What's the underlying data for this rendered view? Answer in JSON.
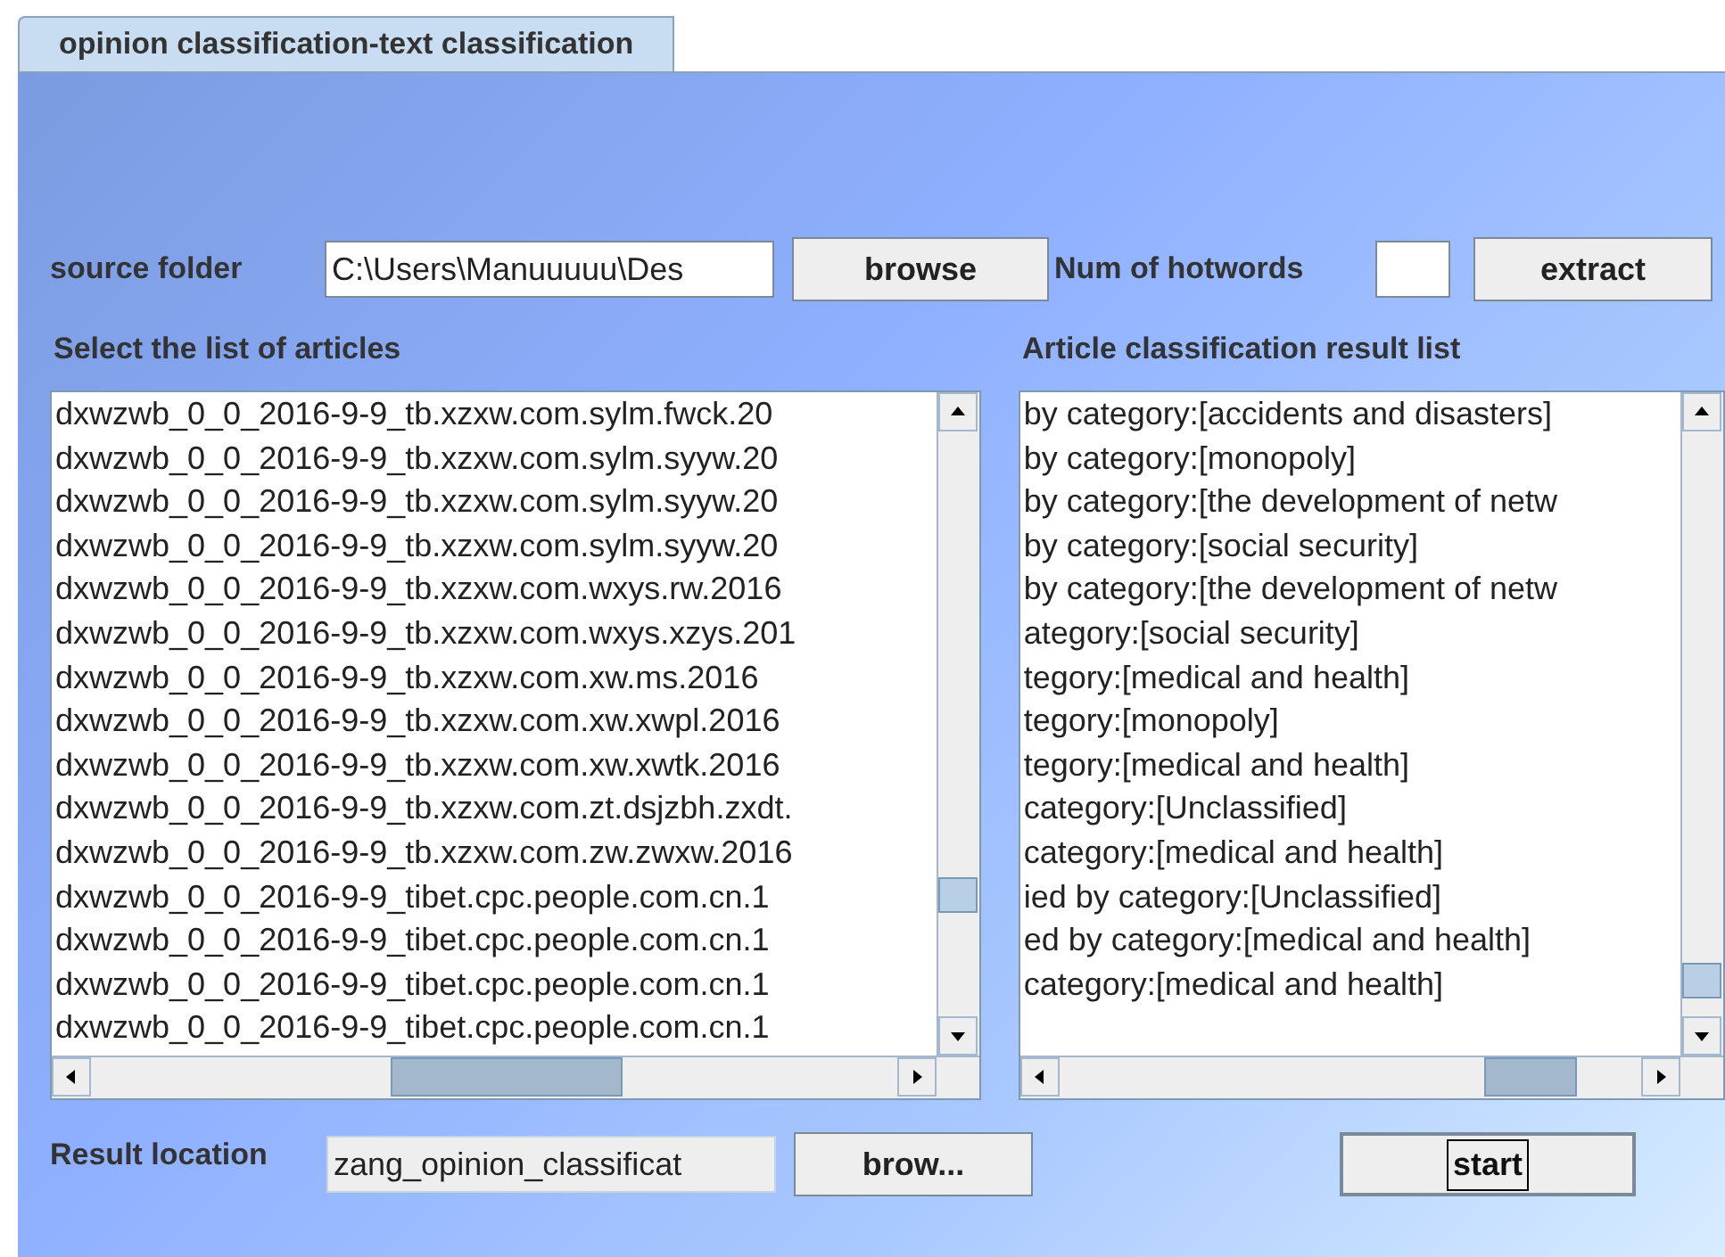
{
  "tabs": [
    {
      "label": "opinion classification-text classification",
      "selected": true
    }
  ],
  "source_folder": {
    "label": "source folder",
    "value": "C:\\Users\\Manuuuuu\\Des",
    "button": "browse"
  },
  "hotwords": {
    "label": "Num of hotwords",
    "button": "extract"
  },
  "articles": {
    "title": "Select the list of articles",
    "items": [
      "dxwzwb_0_0_2016-9-9_tb.xzxw.com.sylm.fwck.20",
      "dxwzwb_0_0_2016-9-9_tb.xzxw.com.sylm.syyw.20",
      "dxwzwb_0_0_2016-9-9_tb.xzxw.com.sylm.syyw.20",
      "dxwzwb_0_0_2016-9-9_tb.xzxw.com.sylm.syyw.20",
      "dxwzwb_0_0_2016-9-9_tb.xzxw.com.wxys.rw.2016",
      "dxwzwb_0_0_2016-9-9_tb.xzxw.com.wxys.xzys.201",
      "dxwzwb_0_0_2016-9-9_tb.xzxw.com.xw.ms.2016",
      "dxwzwb_0_0_2016-9-9_tb.xzxw.com.xw.xwpl.2016",
      "dxwzwb_0_0_2016-9-9_tb.xzxw.com.xw.xwtk.2016",
      "dxwzwb_0_0_2016-9-9_tb.xzxw.com.zt.dsjzbh.zxdt.",
      "dxwzwb_0_0_2016-9-9_tb.xzxw.com.zw.zwxw.2016",
      "dxwzwb_0_0_2016-9-9_tibet.cpc.people.com.cn.1",
      "dxwzwb_0_0_2016-9-9_tibet.cpc.people.com.cn.1",
      "dxwzwb_0_0_2016-9-9_tibet.cpc.people.com.cn.1",
      "dxwzwb_0_0_2016-9-9_tibet.cpc.people.com.cn.1"
    ]
  },
  "results": {
    "title": "Article classification result list",
    "items": [
      "by category:[accidents and disasters]",
      "by category:[monopoly]",
      "by category:[the development of netw",
      "by category:[social security]",
      "by category:[the development of netw",
      "ategory:[social security]",
      "tegory:[medical and health]",
      "tegory:[monopoly]",
      "tegory:[medical and health]",
      "category:[Unclassified]",
      "category:[medical and health]",
      "ied by category:[Unclassified]",
      "ed by category:[medical and health]",
      "category:[medical and health]"
    ]
  },
  "result_location": {
    "label": "Result location",
    "value": "zang_opinion_classificat",
    "button": "brow..."
  },
  "start_button": "start"
}
